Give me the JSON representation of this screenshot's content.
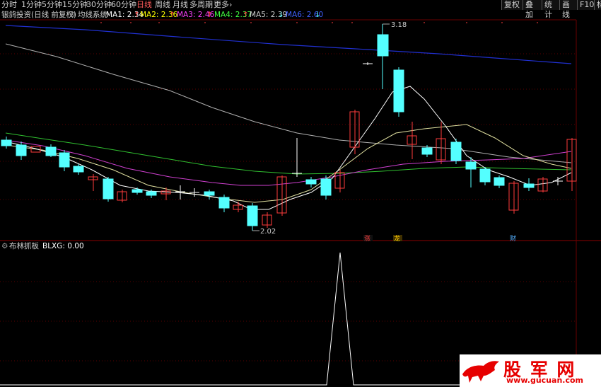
{
  "toolbar": {
    "periods": [
      "分时",
      "1分钟",
      "5分钟",
      "15分钟",
      "30分钟",
      "60分钟",
      "日线",
      "周线",
      "月线",
      "多周期",
      "更多"
    ],
    "active_period": "日线",
    "more_chevron": "›",
    "right_buttons": [
      "复权",
      "叠加",
      "统计",
      "画线",
      "F10",
      "标"
    ]
  },
  "info_bar": {
    "stock": "银鸽投资(日线 前复权)",
    "system": "均线系统",
    "ma": [
      {
        "label": "MA1: 2.34",
        "arrow": "↑",
        "color": "#ffffff"
      },
      {
        "label": "MA2: 2.36",
        "arrow": "↑",
        "color": "#ffff00"
      },
      {
        "label": "MA3: 2.46",
        "arrow": "↑",
        "color": "#ff40ff"
      },
      {
        "label": "MA4: 2.37",
        "arrow": "↑",
        "color": "#40ff40"
      },
      {
        "label": "MA5: 2.39",
        "arrow": "↓",
        "color": "#cccccc"
      },
      {
        "label": "MA6: 2.60",
        "arrow": "↓",
        "color": "#4060ff"
      }
    ]
  },
  "price_labels": {
    "high": "3.18",
    "low": "2.02"
  },
  "markers": {
    "zhang": "涨",
    "long": "龙",
    "cai": "财"
  },
  "indicator": {
    "name": "布林抓板",
    "value": "BLXG: 0.00"
  },
  "watermark": {
    "title": "股 军 网",
    "url": "www.gucuan.com"
  },
  "colors": {
    "up": "#ff3c3c",
    "down": "#54ffff",
    "border": "#6a0000"
  }
}
